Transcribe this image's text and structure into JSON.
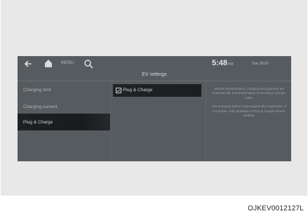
{
  "statusbar": {
    "menu_label": "MENU",
    "clock": "5:48",
    "ampm": "PM",
    "date": "Tue, 09.07"
  },
  "title": "EV settings",
  "left_menu": [
    {
      "label": "Charging limit"
    },
    {
      "label": "Charging current"
    },
    {
      "label": "Plug & Charge",
      "selected": true
    }
  ],
  "option": {
    "label": "Plug & Charge",
    "checked": true
  },
  "description": [
    "Vehicle authentication, charging and payment are automatically performed upon connecting a charger cable.",
    "The charging station must support the registration of a member. Only available at Plug & Charge service stations."
  ],
  "figure_code": "OJKEV0012127L",
  "colors": {
    "screen_bg": "#565b5f",
    "selected_bg": "#1b1d20",
    "frame_bg": "#e8e8e8"
  },
  "icons": [
    "back-arrow-icon",
    "home-icon",
    "search-icon",
    "checkbox-icon"
  ]
}
